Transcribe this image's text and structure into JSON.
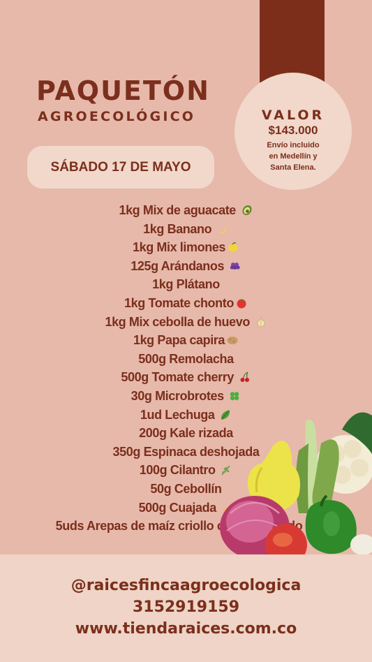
{
  "header": {
    "title_line1": "PAQUETÓN",
    "title_line2": "AGROECOLÓGICO"
  },
  "price": {
    "label": "VALOR",
    "value": "$143.000",
    "note_line1": "Envío incluido",
    "note_line2": "en Medellín y",
    "note_line3": "Santa Elena."
  },
  "date": "SÁBADO 17 DE MAYO",
  "items": [
    {
      "text": "1kg Mix de aguacate",
      "icon": "avocado-icon"
    },
    {
      "text": "1kg Banano",
      "icon": "banana-icon"
    },
    {
      "text": "1kg Mix limones",
      "icon": "lemon-icon"
    },
    {
      "text": "125g Arándanos",
      "icon": "grapes-icon"
    },
    {
      "text": "1kg Plátano",
      "icon": ""
    },
    {
      "text": "1kg Tomate chonto",
      "icon": "tomato-icon"
    },
    {
      "text": "1kg Mix cebolla de huevo",
      "icon": "onion-icon"
    },
    {
      "text": "1kg Papa capira",
      "icon": "potato-icon"
    },
    {
      "text": "500g Remolacha",
      "icon": ""
    },
    {
      "text": "500g Tomate cherry",
      "icon": "cherries-icon"
    },
    {
      "text": "30g Microbrotes",
      "icon": "clover-icon"
    },
    {
      "text": "1ud Lechuga",
      "icon": "leafy-green-icon"
    },
    {
      "text": "200g Kale rizada",
      "icon": ""
    },
    {
      "text": "350g Espinaca deshojada",
      "icon": ""
    },
    {
      "text": "100g Cilantro",
      "icon": "herb-icon"
    },
    {
      "text": "50g Cebollín",
      "icon": ""
    },
    {
      "text": "500g Cuajada",
      "icon": "cheese-icon"
    },
    {
      "text": "5uds Arepas de maíz criollo cariaco rosado",
      "icon": "carrot-icon"
    }
  ],
  "footer": {
    "instagram": "@raicesfincaagroecologica",
    "phone": "3152919159",
    "website": "www.tiendaraices.com.co"
  },
  "colors": {
    "background": "#e6b9ab",
    "brand": "#7b2f1c",
    "panel": "#f1d8cb"
  }
}
